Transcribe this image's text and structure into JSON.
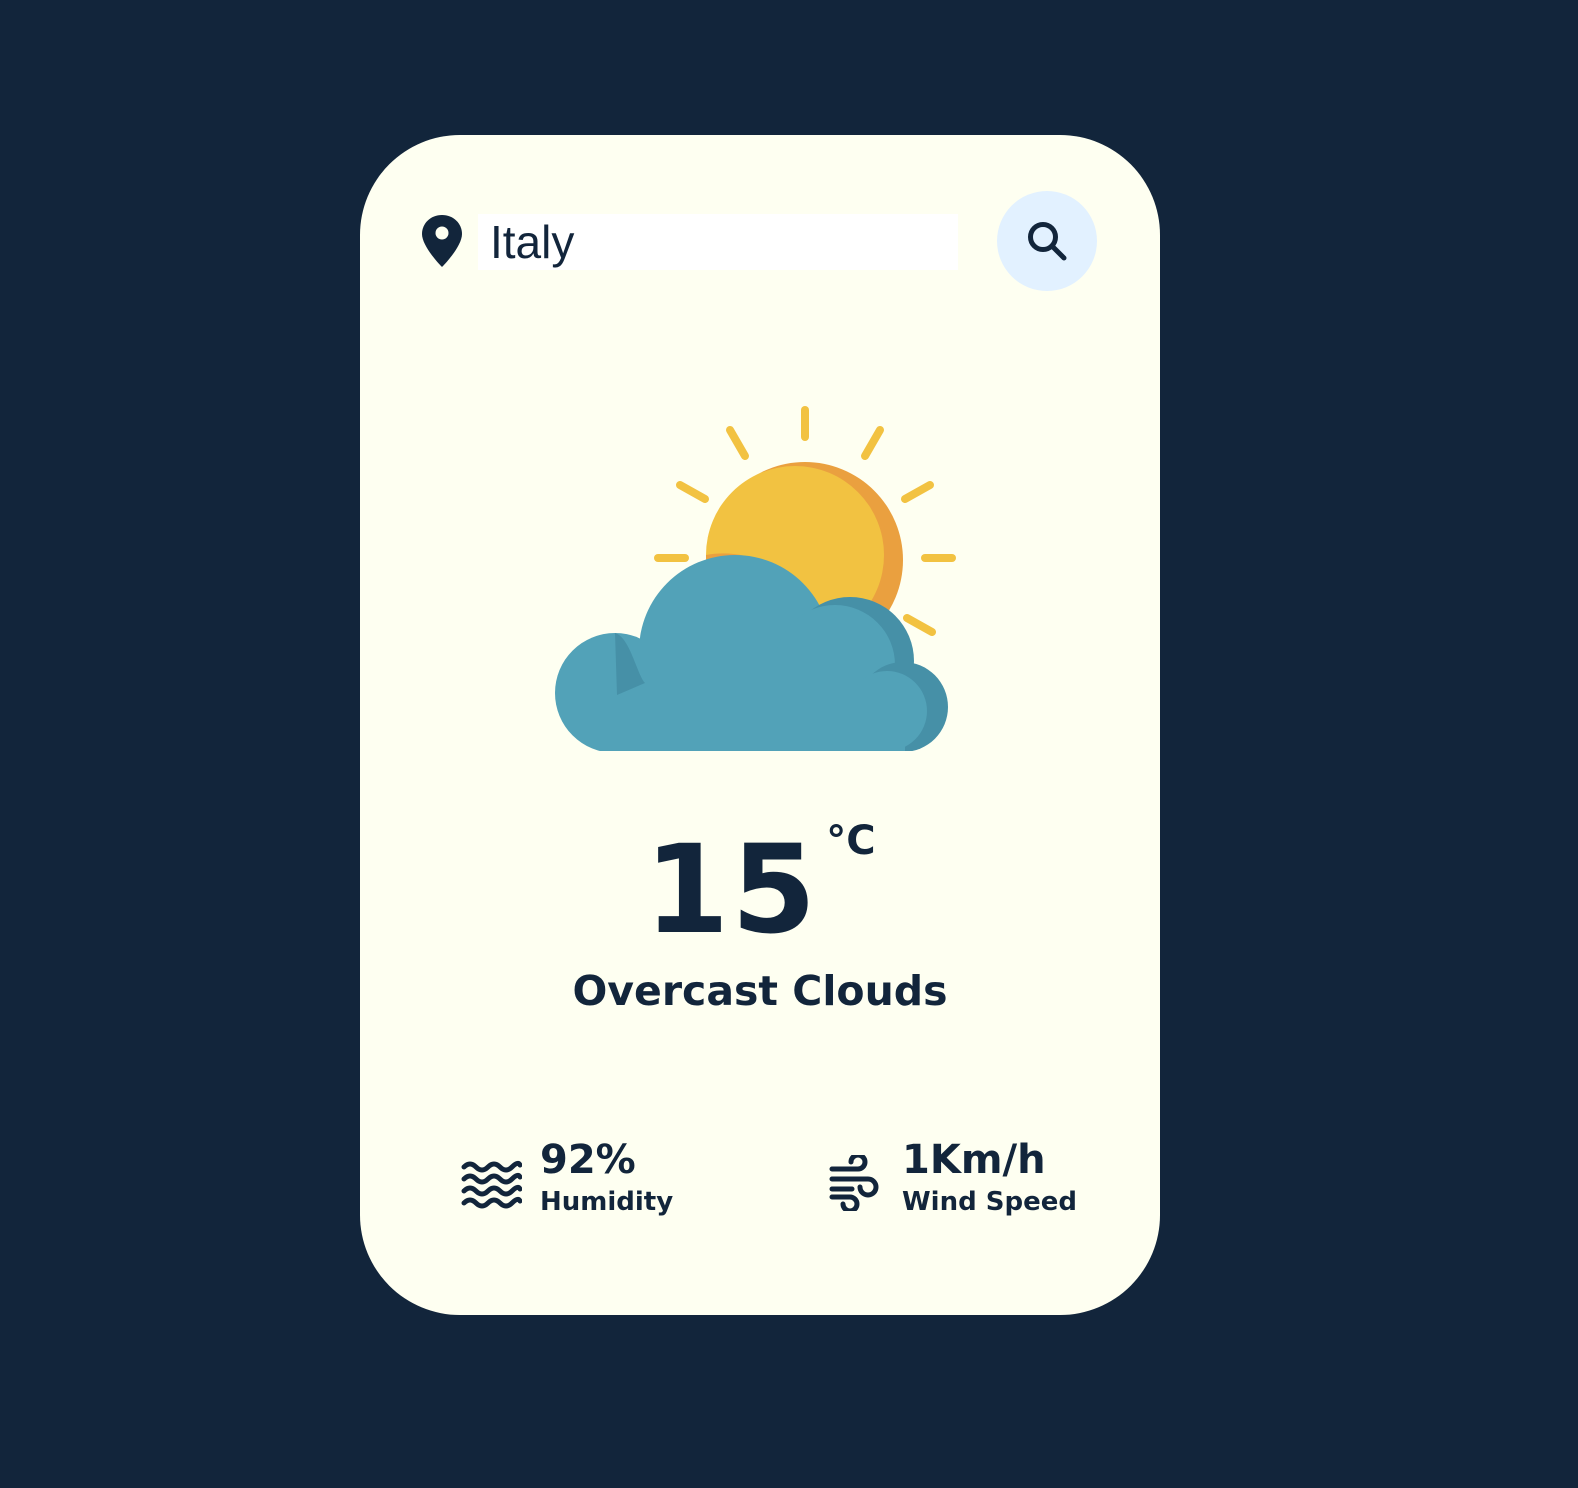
{
  "search": {
    "value": "Italy",
    "location_icon": "map-pin-icon",
    "button_icon": "search-icon"
  },
  "weather": {
    "icon": "sun-behind-cloud-icon",
    "temperature": "15",
    "unit": "°C",
    "description": "Overcast Clouds"
  },
  "details": {
    "humidity": {
      "icon": "humidity-waves-icon",
      "value": "92%",
      "label": "Humidity"
    },
    "wind": {
      "icon": "wind-icon",
      "value": "1Km/h",
      "label": "Wind Speed"
    }
  },
  "colors": {
    "background": "#12253b",
    "card": "#fefff1",
    "text": "#12253b",
    "search_button": "#e2f1ff",
    "sun": "#f2c241",
    "sun_shade": "#eaa03f",
    "cloud": "#52a2b8",
    "cloud_shade": "#4690a7"
  }
}
